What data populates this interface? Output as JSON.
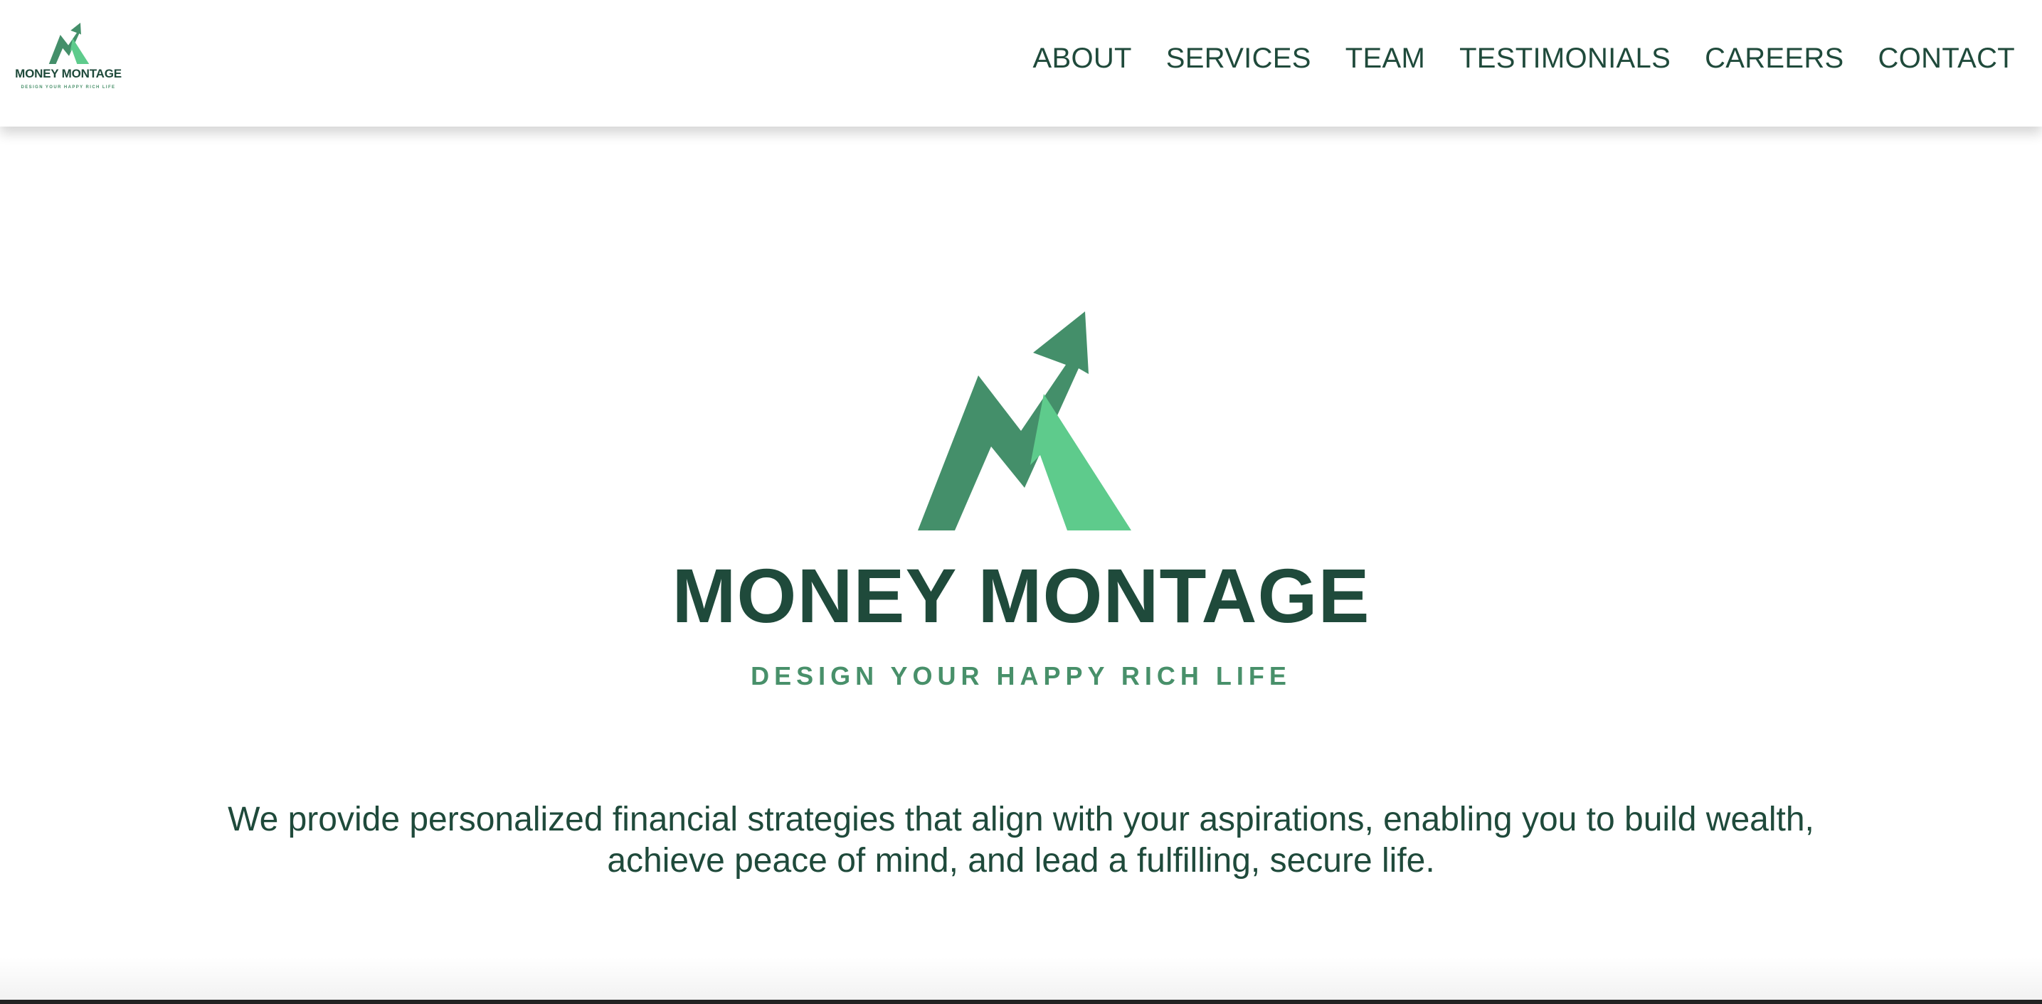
{
  "brand": {
    "name": "MONEY MONTAGE",
    "tagline": "DESIGN YOUR HAPPY RICH LIFE",
    "logo_icon": "mountain-arrow-logo-icon",
    "colors": {
      "dark_green": "#1f4a3b",
      "mid_green": "#448f6a",
      "light_green": "#5ecb8c"
    }
  },
  "nav": {
    "items": [
      {
        "label": "ABOUT"
      },
      {
        "label": "SERVICES"
      },
      {
        "label": "TEAM"
      },
      {
        "label": "TESTIMONIALS"
      },
      {
        "label": "CAREERS"
      },
      {
        "label": "CONTACT"
      }
    ]
  },
  "hero": {
    "title": "MONEY MONTAGE",
    "tagline": "DESIGN YOUR HAPPY RICH LIFE",
    "description": "We provide personalized financial strategies that align with your aspirations, enabling you to build wealth, achieve peace of mind, and lead a fulfilling, secure life."
  }
}
